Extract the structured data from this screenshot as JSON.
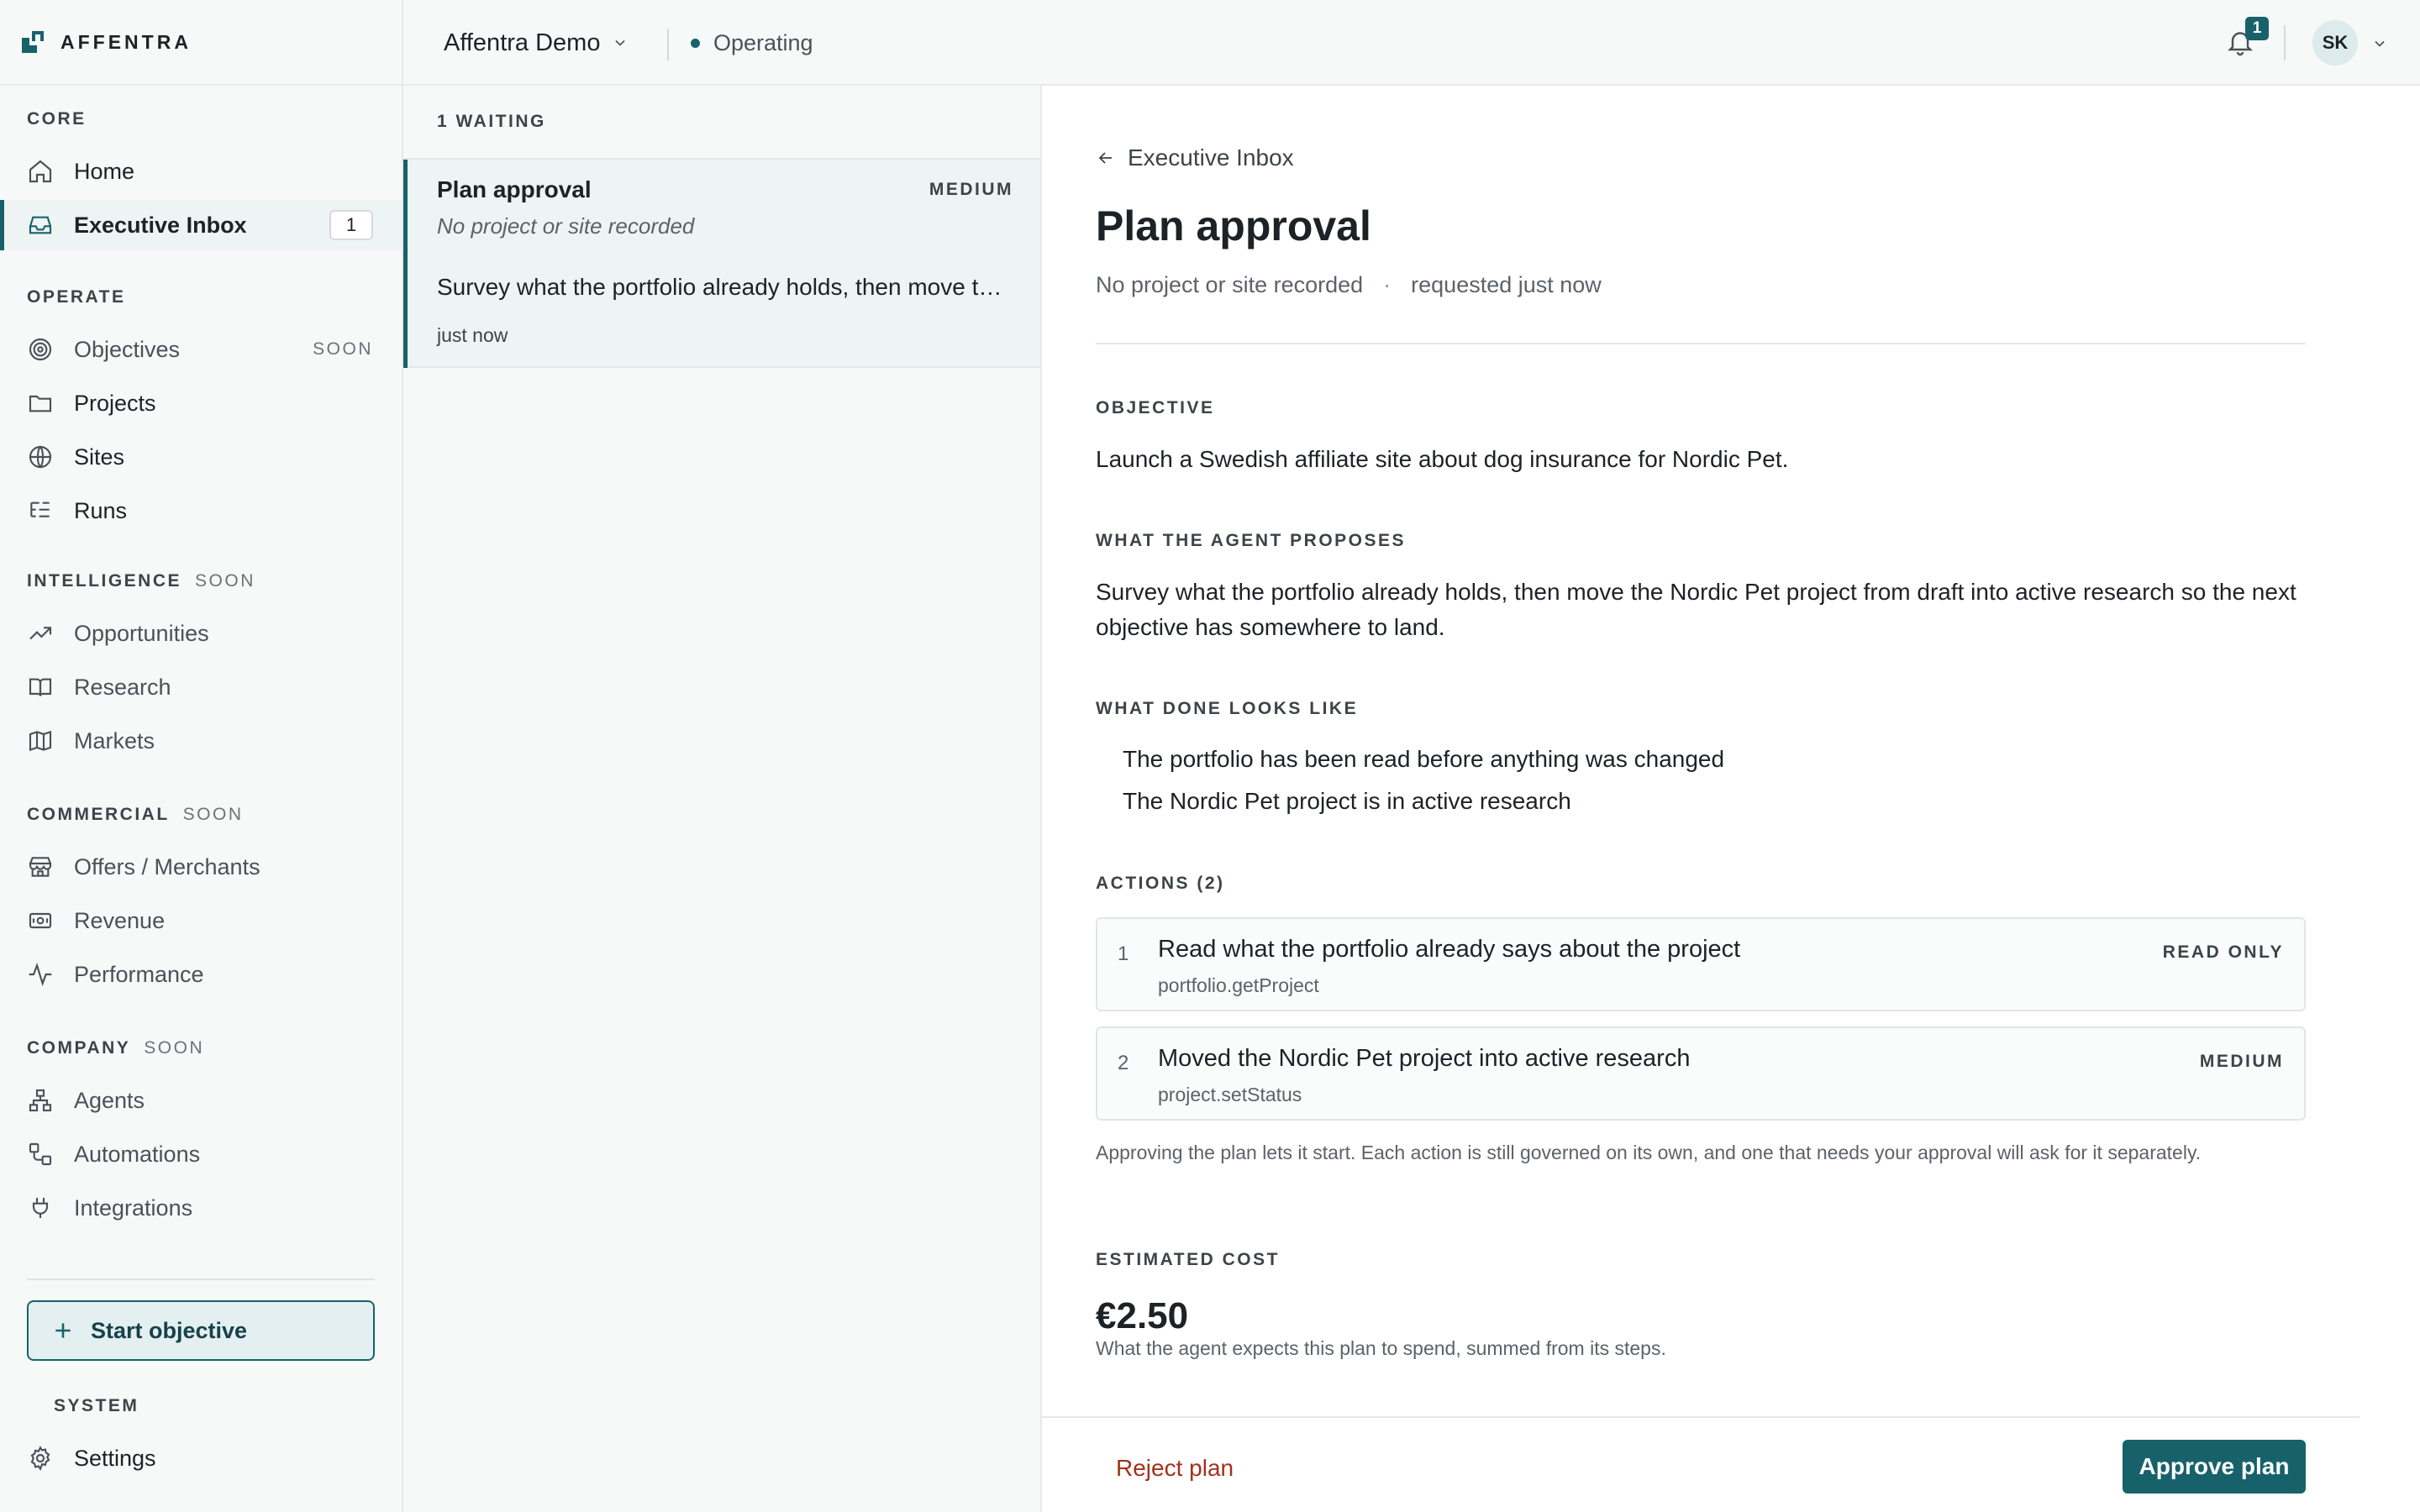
{
  "brand": {
    "name": "AFFENTRA"
  },
  "sidebar": {
    "sections": {
      "core": "CORE",
      "operate": "OPERATE",
      "intelligence": "INTELLIGENCE",
      "commercial": "COMMERCIAL",
      "company": "COMPANY",
      "system": "SYSTEM"
    },
    "soon_label": "SOON",
    "items": [
      {
        "label": "Home",
        "icon": "home-icon"
      },
      {
        "label": "Executive Inbox",
        "icon": "inbox-icon",
        "count": "1",
        "active": true
      },
      {
        "label": "Objectives",
        "icon": "target-icon",
        "badge": "SOON"
      },
      {
        "label": "Projects",
        "icon": "folder-icon"
      },
      {
        "label": "Sites",
        "icon": "globe-icon"
      },
      {
        "label": "Runs",
        "icon": "list-tree-icon"
      },
      {
        "label": "Opportunities",
        "icon": "trending-up-icon"
      },
      {
        "label": "Research",
        "icon": "book-open-icon"
      },
      {
        "label": "Markets",
        "icon": "map-icon"
      },
      {
        "label": "Offers / Merchants",
        "icon": "store-icon"
      },
      {
        "label": "Revenue",
        "icon": "banknote-icon"
      },
      {
        "label": "Performance",
        "icon": "activity-icon"
      },
      {
        "label": "Agents",
        "icon": "network-icon"
      },
      {
        "label": "Automations",
        "icon": "workflow-icon"
      },
      {
        "label": "Integrations",
        "icon": "plug-icon"
      },
      {
        "label": "Settings",
        "icon": "gear-icon"
      }
    ],
    "start_button": "Start objective"
  },
  "topbar": {
    "org": "Affentra Demo",
    "status": "Operating",
    "notifications": "1",
    "avatar": "SK"
  },
  "inbox": {
    "header": "1 WAITING",
    "cards": [
      {
        "title": "Plan approval",
        "priority": "MEDIUM",
        "subtitle": "No project or site recorded",
        "summary": "Survey what the portfolio already holds, then move the Nordic Pet project from draft into active research so the next objective has somewhere to land.",
        "time": "just now"
      }
    ]
  },
  "detail": {
    "back": "Executive Inbox",
    "title": "Plan approval",
    "context": "No project or site recorded",
    "separator": "·",
    "requested": "requested just now",
    "objective_label": "OBJECTIVE",
    "objective": "Launch a Swedish affiliate site about dog insurance for Nordic Pet.",
    "proposal_label": "WHAT THE AGENT PROPOSES",
    "proposal": "Survey what the portfolio already holds, then move the Nordic Pet project from draft into active research so the next objective has somewhere to land.",
    "done_label": "WHAT DONE LOOKS LIKE",
    "done": [
      "The portfolio has been read before anything was changed",
      "The Nordic Pet project is in active research"
    ],
    "actions_label": "ACTIONS (2)",
    "actions": [
      {
        "num": "1",
        "title": "Read what the portfolio already says about the project",
        "code": "portfolio.getProject",
        "risk": "READ ONLY"
      },
      {
        "num": "2",
        "title": "Moved the Nordic Pet project into active research",
        "code": "project.setStatus",
        "risk": "MEDIUM"
      }
    ],
    "note": "Approving the plan lets it start. Each action is still governed on its own, and one that needs your approval will ask for it separately.",
    "cost_label": "ESTIMATED COST",
    "cost": "€2.50",
    "cost_note": "What the agent expects this plan to spend, summed from its steps.",
    "reject": "Reject plan",
    "approve": "Approve plan"
  },
  "colors": {
    "accent": "#17626a",
    "danger": "#a2321c"
  }
}
